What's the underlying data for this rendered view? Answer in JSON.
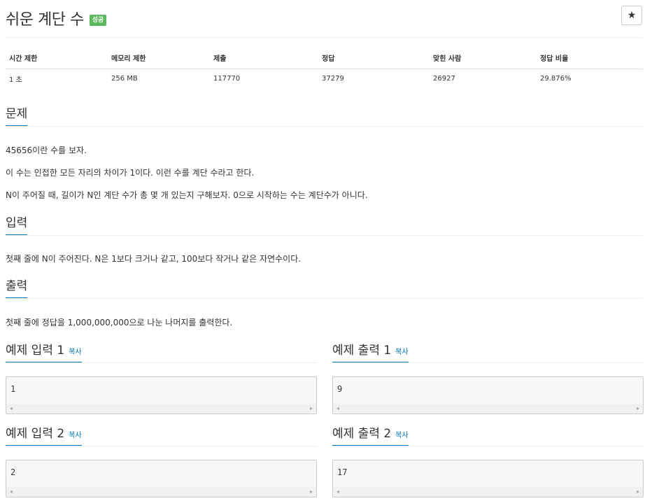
{
  "problem": {
    "title": "쉬운 계단 수",
    "status_badge": "성공",
    "star_icon": "★"
  },
  "info_table": {
    "headers": [
      "시간 제한",
      "메모리 제한",
      "제출",
      "정답",
      "맞힌 사람",
      "정답 비율"
    ],
    "values": [
      "1 초",
      "256 MB",
      "117770",
      "37279",
      "26927",
      "29.876%"
    ]
  },
  "sections": {
    "problem": {
      "heading": "문제",
      "paragraphs": [
        "45656이란 수를 보자.",
        "이 수는 인접한 모든 자리의 차이가 1이다. 이런 수를 계단 수라고 한다.",
        "N이 주어질 때, 길이가 N인 계단 수가 총 몇 개 있는지 구해보자. 0으로 시작하는 수는 계단수가 아니다."
      ]
    },
    "input": {
      "heading": "입력",
      "paragraphs": [
        "첫째 줄에 N이 주어진다. N은 1보다 크거나 같고, 100보다 작거나 같은 자연수이다."
      ]
    },
    "output": {
      "heading": "출력",
      "paragraphs": [
        "첫째 줄에 정답을 1,000,000,000으로 나눈 나머지를 출력한다."
      ]
    }
  },
  "samples": [
    {
      "title": "예제 입력 1",
      "copy": "복사",
      "value": "1"
    },
    {
      "title": "예제 출력 1",
      "copy": "복사",
      "value": "9"
    },
    {
      "title": "예제 입력 2",
      "copy": "복사",
      "value": "2"
    },
    {
      "title": "예제 출력 2",
      "copy": "복사",
      "value": "17"
    }
  ],
  "scroll_arrows": {
    "left": "◂",
    "right": "▸"
  }
}
